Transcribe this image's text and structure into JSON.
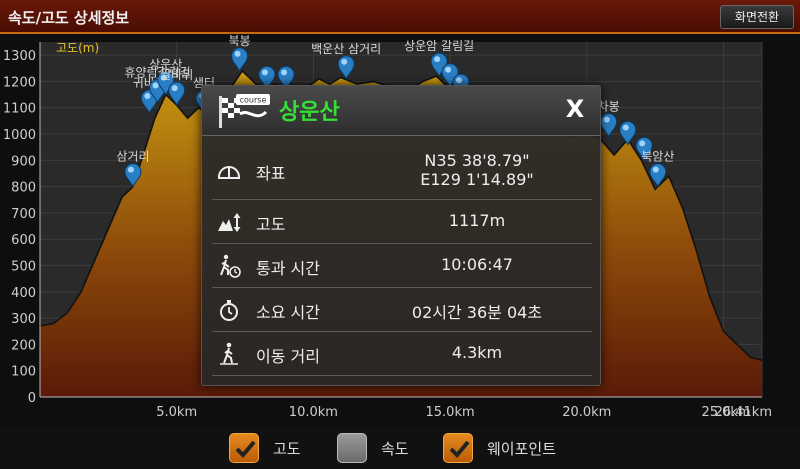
{
  "header": {
    "title": "속도/고도 상세정보",
    "switch_button": "화면전환"
  },
  "chart_data": {
    "type": "area",
    "series_label": "고도(m)",
    "ylim": [
      0,
      1350
    ],
    "xlim": [
      0,
      26.41
    ],
    "y_ticks": [
      0,
      100,
      200,
      300,
      400,
      500,
      600,
      700,
      800,
      900,
      1000,
      1100,
      1200,
      1300
    ],
    "x_ticks": [
      {
        "value": 5.0,
        "label": "5.0km"
      },
      {
        "value": 10.0,
        "label": "10.0km"
      },
      {
        "value": 15.0,
        "label": "15.0km"
      },
      {
        "value": 20.0,
        "label": "20.0km"
      },
      {
        "value": 25.0,
        "label": "25.0km"
      },
      {
        "value": 26.41,
        "label": "26.41km"
      }
    ],
    "points": [
      [
        0,
        270
      ],
      [
        0.5,
        280
      ],
      [
        1.0,
        320
      ],
      [
        1.5,
        400
      ],
      [
        2.0,
        520
      ],
      [
        2.5,
        640
      ],
      [
        3.0,
        760
      ],
      [
        3.4,
        800
      ],
      [
        3.8,
        930
      ],
      [
        4.2,
        1060
      ],
      [
        4.6,
        1150
      ],
      [
        5.0,
        1110
      ],
      [
        5.4,
        1060
      ],
      [
        5.8,
        1100
      ],
      [
        6.2,
        1070
      ],
      [
        6.6,
        1140
      ],
      [
        7.0,
        1180
      ],
      [
        7.4,
        1240
      ],
      [
        7.8,
        1200
      ],
      [
        8.2,
        1160
      ],
      [
        8.6,
        1190
      ],
      [
        9.0,
        1160
      ],
      [
        9.4,
        1140
      ],
      [
        9.8,
        1180
      ],
      [
        10.2,
        1210
      ],
      [
        10.6,
        1190
      ],
      [
        11.0,
        1215
      ],
      [
        11.6,
        1190
      ],
      [
        12.2,
        1200
      ],
      [
        12.8,
        1180
      ],
      [
        13.4,
        1160
      ],
      [
        14.0,
        1200
      ],
      [
        14.5,
        1220
      ],
      [
        15.0,
        1170
      ],
      [
        15.5,
        1130
      ],
      [
        16.0,
        1150
      ],
      [
        16.5,
        1120
      ],
      [
        17.0,
        1080
      ],
      [
        17.5,
        1100
      ],
      [
        18.0,
        1060
      ],
      [
        18.5,
        1030
      ],
      [
        19.0,
        1010
      ],
      [
        19.5,
        990
      ],
      [
        20.0,
        1000
      ],
      [
        20.5,
        980
      ],
      [
        21.0,
        920
      ],
      [
        21.5,
        980
      ],
      [
        22.0,
        900
      ],
      [
        22.5,
        790
      ],
      [
        23.0,
        840
      ],
      [
        23.5,
        720
      ],
      [
        24.0,
        560
      ],
      [
        24.5,
        380
      ],
      [
        25.0,
        250
      ],
      [
        25.5,
        200
      ],
      [
        26.0,
        150
      ],
      [
        26.41,
        140
      ]
    ],
    "waypoints": [
      {
        "x": 3.4,
        "y": 800,
        "label": "삼거리"
      },
      {
        "x": 4.0,
        "y": 1080,
        "label": "귀바위"
      },
      {
        "x": 4.3,
        "y": 1120,
        "label": "휴양림갈림길"
      },
      {
        "x": 4.6,
        "y": 1150,
        "label": "상운산"
      },
      {
        "x": 5.0,
        "y": 1110,
        "label": "쌀바위"
      },
      {
        "x": 6.0,
        "y": 1080,
        "label": "샘터"
      },
      {
        "x": 7.3,
        "y": 1240,
        "label": "북봉"
      },
      {
        "x": 8.3,
        "y": 1170,
        "label": ""
      },
      {
        "x": 9.0,
        "y": 1170,
        "label": ""
      },
      {
        "x": 11.2,
        "y": 1210,
        "label": "백운산 삼거리"
      },
      {
        "x": 14.6,
        "y": 1220,
        "label": "상운암 갈림길"
      },
      {
        "x": 15.0,
        "y": 1180,
        "label": ""
      },
      {
        "x": 15.4,
        "y": 1140,
        "label": ""
      },
      {
        "x": 20.8,
        "y": 990,
        "label": "차봉"
      },
      {
        "x": 21.5,
        "y": 960,
        "label": ""
      },
      {
        "x": 22.1,
        "y": 900,
        "label": ""
      },
      {
        "x": 22.6,
        "y": 800,
        "label": "북암산"
      }
    ]
  },
  "panel": {
    "title": "상운산",
    "close_label": "X",
    "course_badge": "course",
    "rows": [
      {
        "icon": "coordinate-icon",
        "label": "좌표",
        "value_line1": "N35 38'8.79\"",
        "value_line2": "E129 1'14.89\""
      },
      {
        "icon": "altitude-icon",
        "label": "고도",
        "value_line1": "1117m"
      },
      {
        "icon": "pass-time-icon",
        "label": "통과 시간",
        "value_line1": "10:06:47"
      },
      {
        "icon": "stopwatch-icon",
        "label": "소요 시간",
        "value_line1": "02시간 36분 04초"
      },
      {
        "icon": "walker-icon",
        "label": "이동 거리",
        "value_line1": "4.3km"
      }
    ]
  },
  "legend": {
    "items": [
      {
        "label": "고도",
        "checked": true
      },
      {
        "label": "속도",
        "checked": false
      },
      {
        "label": "웨이포인트",
        "checked": true
      }
    ]
  },
  "colors": {
    "accent_orange": "#e58a1e",
    "title_green": "#33e033",
    "header_red": "#5a1205",
    "waypoint_blue": "#2a7fc4"
  }
}
